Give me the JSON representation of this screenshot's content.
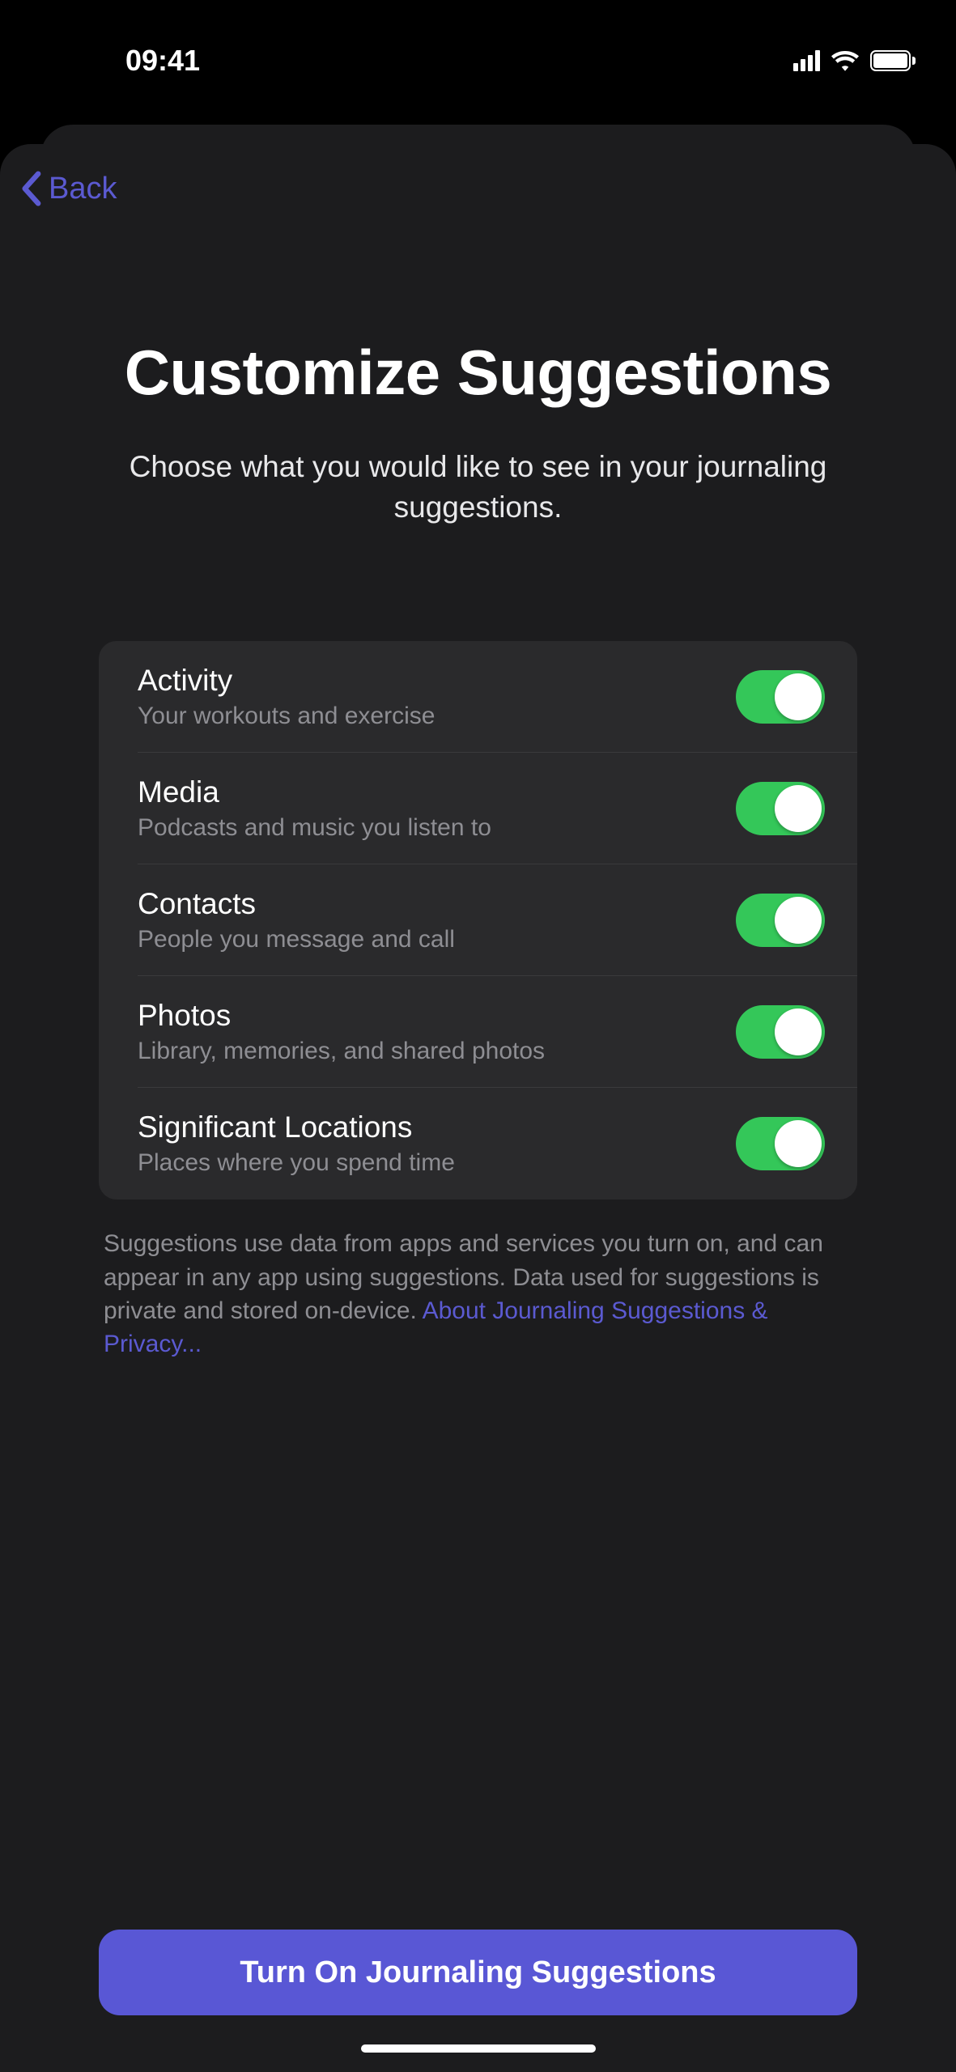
{
  "status": {
    "time": "09:41"
  },
  "nav": {
    "back_label": "Back"
  },
  "header": {
    "title": "Customize Suggestions",
    "subtitle": "Choose what you would like to see in your journaling suggestions."
  },
  "options": [
    {
      "title": "Activity",
      "desc": "Your workouts and exercise",
      "on": true
    },
    {
      "title": "Media",
      "desc": "Podcasts and music you listen to",
      "on": true
    },
    {
      "title": "Contacts",
      "desc": "People you message and call",
      "on": true
    },
    {
      "title": "Photos",
      "desc": "Library, memories, and shared photos",
      "on": true
    },
    {
      "title": "Significant Locations",
      "desc": "Places where you spend time",
      "on": true
    }
  ],
  "footer": {
    "text": "Suggestions use data from apps and services you turn on, and can appear in any app using suggestions. Data used for suggestions is private and stored on-device. ",
    "link": "About Journaling Suggestions & Privacy..."
  },
  "primary_button": "Turn On Journaling Suggestions"
}
